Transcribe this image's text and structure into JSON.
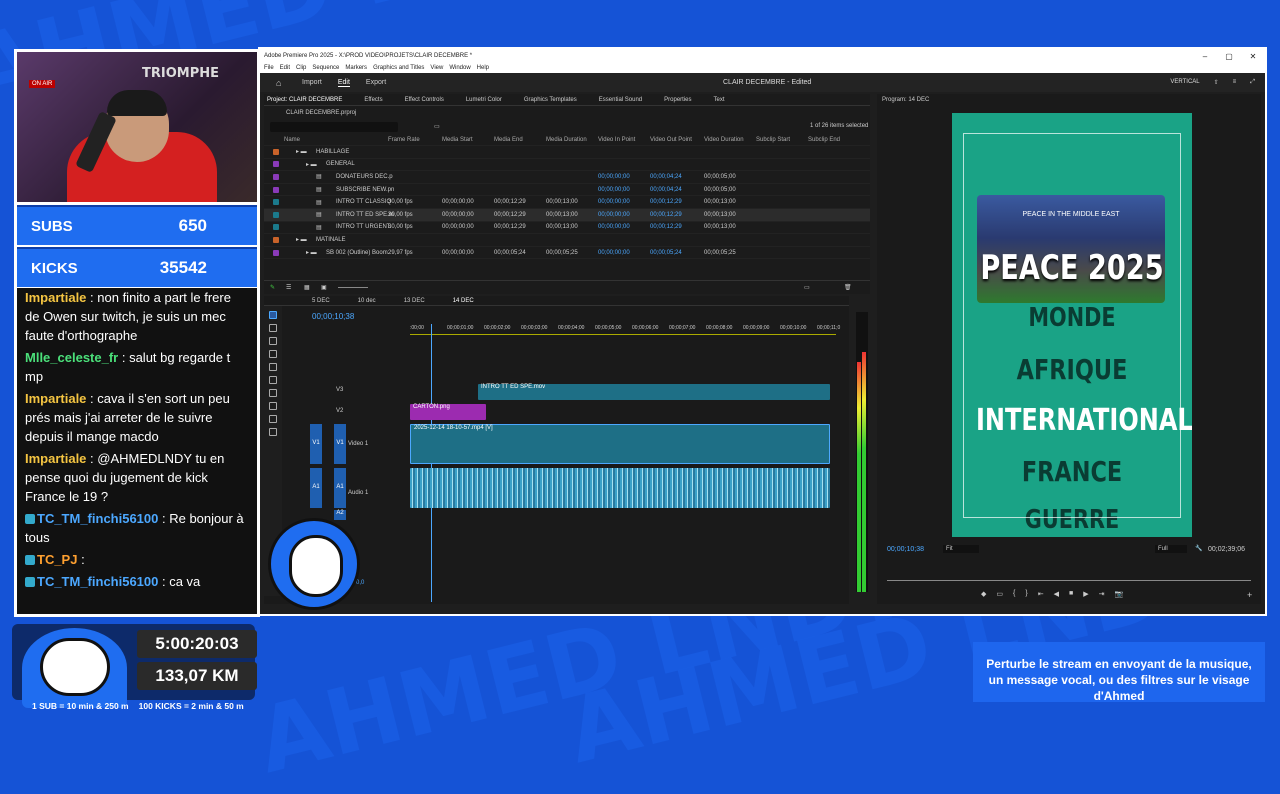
{
  "background": {
    "watermark": "AHMED LNDY",
    "accent": "#1553d6"
  },
  "stream": {
    "subs_label": "SUBS",
    "subs_value": "650",
    "kicks_label": "KICKS",
    "kicks_value": "35542",
    "webcam_sign": "TRIOMPHE",
    "timer": "5:00:20:03",
    "distance": "133,07 KM",
    "legend": [
      "1 SUB = 10 min & 250 m",
      "100 KICKS = 2 min & 50 m"
    ],
    "info_line1": "Perturbe le stream en envoyant de la musique,",
    "info_line2": "un message vocal, ou des filtres sur le visage d'Ahmed"
  },
  "chat": [
    {
      "user": "Impartiale",
      "text": "non finito a part le frere de Owen sur twitch, je suis un mec faute d'orthographe",
      "color": "gold"
    },
    {
      "user": "Mlle_celeste_fr",
      "text": "salut bg regarde t mp",
      "color": "green"
    },
    {
      "user": "Impartiale",
      "text": "cava il s'en sort un peu prés mais j'ai arreter de le suivre depuis il mange macdo",
      "color": "gold"
    },
    {
      "user": "Impartiale",
      "text": "@AHMEDLNDY tu en pense quoi du jugement de kick France le 19 ?",
      "color": "gold"
    },
    {
      "user": "TC_TM_finchi56100",
      "text": "Re bonjour à tous",
      "color": "blue"
    },
    {
      "user": "TC_PJ",
      "text": "",
      "color": "orange"
    },
    {
      "user": "TC_TM_finchi56100",
      "text": "ca va",
      "color": "blue"
    }
  ],
  "premiere": {
    "window_title": "Adobe Premiere Pro 2025 - X:\\PROD VIDEO\\PROJETS\\CLAIR DECEMBRE *",
    "menu": [
      "File",
      "Edit",
      "Clip",
      "Sequence",
      "Markers",
      "Graphics and Titles",
      "View",
      "Window",
      "Help"
    ],
    "nav": [
      "Import",
      "Edit",
      "Export"
    ],
    "project_title": "CLAIR DECEMBRE - Edited",
    "workspace": "VERTICAL",
    "panel_tabs": [
      "Project: CLAIR DECEMBRE",
      "Effects",
      "Effect Controls",
      "Lumetri Color",
      "Graphics Templates",
      "Essential Sound",
      "Properties",
      "Text"
    ],
    "project_file": "CLAIR DECEMBRE.prproj",
    "items_selected": "1 of 26 items selected",
    "columns": [
      "Name",
      "Frame Rate",
      "Media Start",
      "Media End",
      "Media Duration",
      "Video In Point",
      "Video Out Point",
      "Video Duration",
      "Subclip Start",
      "Subclip End"
    ],
    "rows": [
      {
        "name": "HABILLAGE",
        "fr": "",
        "ms": "",
        "me": "",
        "md": "",
        "vi": "",
        "vo": "",
        "vd": "",
        "color": "#c9632a",
        "indent": 0
      },
      {
        "name": "GENERAL",
        "fr": "",
        "ms": "",
        "me": "",
        "md": "",
        "vi": "",
        "vo": "",
        "vd": "",
        "color": "#8a3ab9",
        "indent": 1
      },
      {
        "name": "DONATEURS DEC.p",
        "fr": "",
        "ms": "",
        "me": "",
        "md": "",
        "vi": "00;00;00;00",
        "vo": "00;00;04;24",
        "vd": "00;00;05;00",
        "color": "#8a3ab9",
        "indent": 2
      },
      {
        "name": "SUBSCRIBE NEW.pn",
        "fr": "",
        "ms": "",
        "me": "",
        "md": "",
        "vi": "00;00;00;00",
        "vo": "00;00;04;24",
        "vd": "00;00;05;00",
        "color": "#8a3ab9",
        "indent": 2
      },
      {
        "name": "INTRO TT CLASSIQ",
        "fr": "30,00 fps",
        "ms": "00;00;00;00",
        "me": "00;00;12;29",
        "md": "00;00;13;00",
        "vi": "00;00;00;00",
        "vo": "00;00;12;29",
        "vd": "00;00;13;00",
        "color": "#1b7a8c",
        "indent": 2
      },
      {
        "name": "INTRO TT ED SPE.m",
        "fr": "30,00 fps",
        "ms": "00;00;00;00",
        "me": "00;00;12;29",
        "md": "00;00;13;00",
        "vi": "00;00;00;00",
        "vo": "00;00;12;29",
        "vd": "00;00;13;00",
        "color": "#1b7a8c",
        "indent": 2,
        "sel": true
      },
      {
        "name": "INTRO TT URGENT.",
        "fr": "30,00 fps",
        "ms": "00;00;00;00",
        "me": "00;00;12;29",
        "md": "00;00;13;00",
        "vi": "00;00;00;00",
        "vo": "00;00;12;29",
        "vd": "00;00;13;00",
        "color": "#1b7a8c",
        "indent": 2
      },
      {
        "name": "MATINALE",
        "fr": "",
        "ms": "",
        "me": "",
        "md": "",
        "vi": "",
        "vo": "",
        "vd": "",
        "color": "#c9632a",
        "indent": 0
      },
      {
        "name": "SB 002 (Outline) Boom.",
        "fr": "29,97 fps",
        "ms": "00;00;00;00",
        "me": "00;00;05;24",
        "md": "00;00;05;25",
        "vi": "00;00;00;00",
        "vo": "00;00;05;24",
        "vd": "00;00;05;25",
        "color": "#8a3ab9",
        "indent": 1
      }
    ],
    "timeline_tabs": [
      "5 DEC",
      "10 dec",
      "13 DEC",
      "14 DEC"
    ],
    "timecode": "00;00;10;38",
    "ruler": [
      ":00;00",
      "00;00;01;00",
      "00;00;02;00",
      "00;00;03;00",
      "00;00;04;00",
      "00;00;05;00",
      "00;00;06;00",
      "00;00;07;00",
      "00;00;08;00",
      "00;00;09;00",
      "00;00;10;00",
      "00;00;11;0"
    ],
    "tracks": {
      "v3": "V3",
      "v2": "V2",
      "v1": "V1",
      "video1": "Video 1",
      "a1": "A1",
      "audio1": "Audio 1",
      "a2": "A2",
      "vol": "0,0"
    },
    "clips": {
      "v3": "INTRO TT ED SPE.mov",
      "v2": "CARTON.png",
      "v1": "2025-12-14 18-10-57.mp4 [V]"
    },
    "program_title": "Program: 14 DEC",
    "program_tc": "00;00;10;38",
    "fit": "Fit",
    "full": "Full",
    "duration": "00;02;39;06",
    "canvas": {
      "photo_caption": "PEACE IN THE MIDDLE EAST",
      "peace": "PEACE 2025",
      "monde": "MONDE",
      "afrique": "AFRIQUE",
      "international": "INTERNATIONAL",
      "france": "FRANCE",
      "guerre": "GUERRE"
    },
    "meter_label": "S S"
  }
}
